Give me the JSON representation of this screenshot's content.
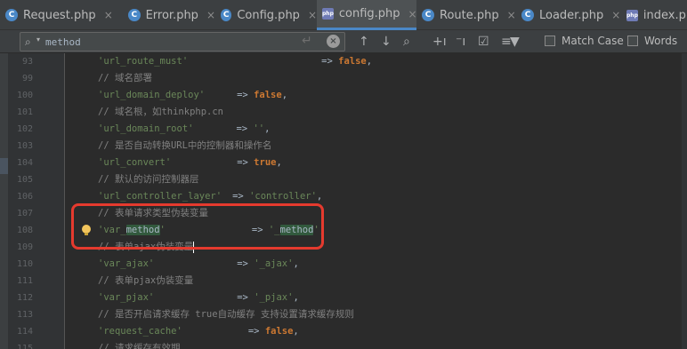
{
  "tabs": [
    {
      "label": "Request.php",
      "icon": "php-class-icon",
      "active": false
    },
    {
      "label": "Error.php",
      "icon": "php-class-icon",
      "active": false
    },
    {
      "label": "Config.php",
      "icon": "php-class-icon",
      "active": false
    },
    {
      "label": "config.php",
      "icon": "php-file-icon",
      "active": true
    },
    {
      "label": "Route.php",
      "icon": "php-class-icon",
      "active": false
    },
    {
      "label": "Loader.php",
      "icon": "php-class-icon",
      "active": false
    },
    {
      "label": "index.ph",
      "icon": "php-file-icon",
      "active": false
    }
  ],
  "search": {
    "value": "method",
    "match_case_label": "Match Case",
    "words_label": "Words"
  },
  "lines": [
    {
      "num": "93"
    },
    {
      "num": "99"
    },
    {
      "num": "100"
    },
    {
      "num": "101"
    },
    {
      "num": "102"
    },
    {
      "num": "103"
    },
    {
      "num": "104"
    },
    {
      "num": "105"
    },
    {
      "num": "106"
    },
    {
      "num": "107"
    },
    {
      "num": "108"
    },
    {
      "num": "109"
    },
    {
      "num": "110"
    },
    {
      "num": "111"
    },
    {
      "num": "112"
    },
    {
      "num": "113"
    },
    {
      "num": "114"
    },
    {
      "num": "115"
    }
  ],
  "code": {
    "l0_key": "'url_route_must'",
    "l0_val": "false",
    "l1": "// 域名部署",
    "l2_key": "'url_domain_deploy'",
    "l2_val": "false",
    "l3": "// 域名根，如thinkphp.cn",
    "l4_key": "'url_domain_root'",
    "l4_val": "''",
    "l5": "// 是否自动转换URL中的控制器和操作名",
    "l6_key": "'url_convert'",
    "l6_val": "true",
    "l7": "// 默认的访问控制器层",
    "l8_key": "'url_controller_layer'",
    "l8_val": "'controller'",
    "l9": "// 表单请求类型伪装变量",
    "l10_key_a": "'var_",
    "l10_key_b": "method",
    "l10_key_c": "'",
    "l10_val_a": "'_",
    "l10_val_b": "method",
    "l10_val_c": "'",
    "l11_a": "// 表单ajax伪装变量",
    "l12_key": "'var_ajax'",
    "l12_val": "'_ajax'",
    "l13": "// 表单pjax伪装变量",
    "l14_key": "'var_pjax'",
    "l14_val": "'_pjax'",
    "l15": "// 是否开启请求缓存 true自动缓存 支持设置请求缓存规则",
    "l16_key": "'request_cache'",
    "l16_val": "false",
    "l17": "// 请求缓存有效期",
    "arrow": "=>",
    "comma": ","
  },
  "colors": {
    "highlight": "#e53a2e",
    "accent": "#4a88c7"
  }
}
